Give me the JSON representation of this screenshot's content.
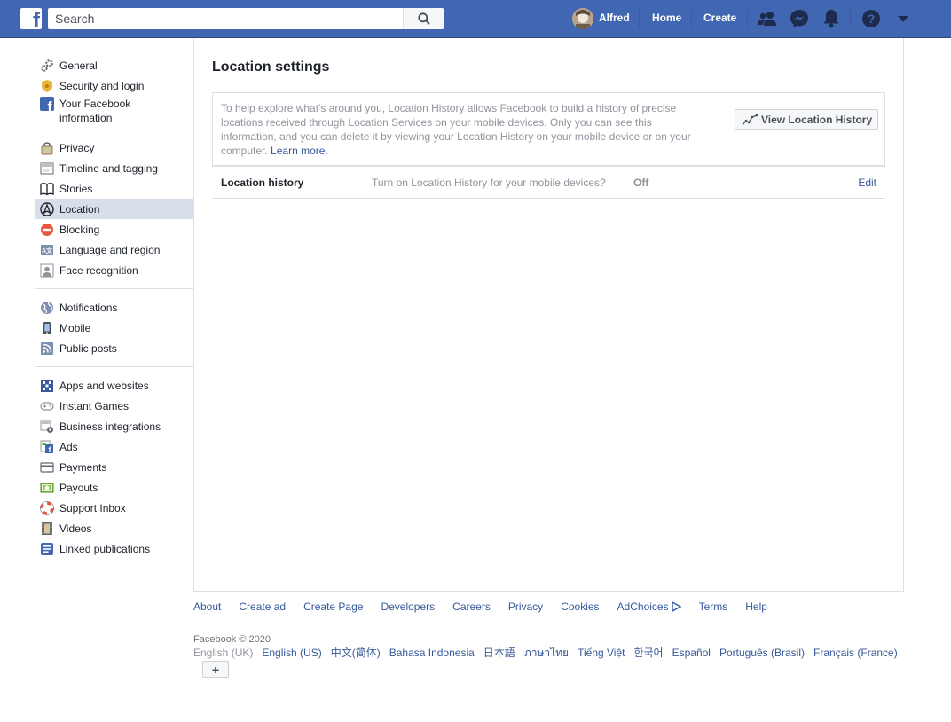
{
  "topbar": {
    "logo": "f",
    "search_placeholder": "Search",
    "user_name": "Alfred",
    "home_label": "Home",
    "create_label": "Create",
    "icons": [
      "friends-icon",
      "messenger-icon",
      "notifications-icon",
      "help-icon",
      "account-menu-icon"
    ]
  },
  "sidebar": {
    "groups": [
      {
        "items": [
          {
            "label": "General",
            "icon": "gears-icon"
          },
          {
            "label": "Security and login",
            "icon": "shield-icon"
          },
          {
            "label": "Your Facebook information",
            "icon": "facebook-icon"
          }
        ]
      },
      {
        "items": [
          {
            "label": "Privacy",
            "icon": "lock-icon"
          },
          {
            "label": "Timeline and tagging",
            "icon": "timeline-icon"
          },
          {
            "label": "Stories",
            "icon": "book-icon"
          },
          {
            "label": "Location",
            "icon": "location-icon",
            "active": true
          },
          {
            "label": "Blocking",
            "icon": "block-icon"
          },
          {
            "label": "Language and region",
            "icon": "language-icon"
          },
          {
            "label": "Face recognition",
            "icon": "face-icon"
          }
        ]
      },
      {
        "items": [
          {
            "label": "Notifications",
            "icon": "globe-icon"
          },
          {
            "label": "Mobile",
            "icon": "phone-icon"
          },
          {
            "label": "Public posts",
            "icon": "rss-icon"
          }
        ]
      },
      {
        "items": [
          {
            "label": "Apps and websites",
            "icon": "apps-icon"
          },
          {
            "label": "Instant Games",
            "icon": "gamepad-icon"
          },
          {
            "label": "Business integrations",
            "icon": "business-icon"
          },
          {
            "label": "Ads",
            "icon": "ads-icon"
          },
          {
            "label": "Payments",
            "icon": "card-icon"
          },
          {
            "label": "Payouts",
            "icon": "money-icon"
          },
          {
            "label": "Support Inbox",
            "icon": "lifebuoy-icon"
          },
          {
            "label": "Videos",
            "icon": "film-icon"
          },
          {
            "label": "Linked publications",
            "icon": "publication-icon"
          }
        ]
      }
    ]
  },
  "main": {
    "title": "Location settings",
    "info_text": "To help explore what's around you, Location History allows Facebook to build a history of precise locations received through Location Services on your mobile devices. Only you can see this information, and you can delete it by viewing your Location History on your mobile device or on your computer.",
    "learn_more": "Learn more.",
    "view_button": "View Location History",
    "setting": {
      "name": "Location history",
      "description": "Turn on Location History for your mobile devices?",
      "value": "Off",
      "edit": "Edit"
    }
  },
  "footer": {
    "links": [
      "About",
      "Create ad",
      "Create Page",
      "Developers",
      "Careers",
      "Privacy",
      "Cookies",
      "AdChoices",
      "Terms",
      "Help"
    ],
    "copyright": "Facebook © 2020",
    "languages": [
      "English (UK)",
      "English (US)",
      "中文(简体)",
      "Bahasa Indonesia",
      "日本語",
      "ภาษาไทย",
      "Tiếng Việt",
      "한국어",
      "Español",
      "Português (Brasil)",
      "Français (France)"
    ],
    "more_languages": "+"
  },
  "colors": {
    "brand": "#4267b2",
    "active_item": "#d8dfea",
    "link": "#365899",
    "muted": "#90949c"
  }
}
